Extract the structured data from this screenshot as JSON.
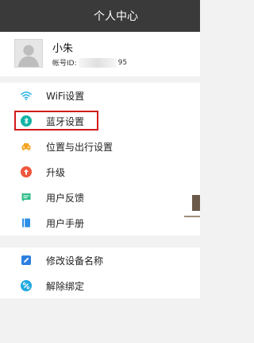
{
  "header": {
    "title": "个人中心"
  },
  "profile": {
    "name": "小朱",
    "account_label": "帐号ID:",
    "account_id_suffix": "95"
  },
  "menu_group_1": [
    {
      "label": "WiFi设置",
      "icon": "wifi-icon",
      "color": "#2db2e8"
    },
    {
      "label": "蓝牙设置",
      "icon": "bluetooth-icon",
      "color": "#12b3a5"
    },
    {
      "label": "位置与出行设置",
      "icon": "car-icon",
      "color": "#f5a623"
    },
    {
      "label": "升级",
      "icon": "upgrade-icon",
      "color": "#f0563c"
    },
    {
      "label": "用户反馈",
      "icon": "feedback-icon",
      "color": "#2fbf8a"
    },
    {
      "label": "用户手册",
      "icon": "manual-icon",
      "color": "#2d8fe6"
    }
  ],
  "menu_group_2": [
    {
      "label": "修改设备名称",
      "icon": "edit-icon",
      "color": "#2d7fe0"
    },
    {
      "label": "解除绑定",
      "icon": "unbind-icon",
      "color": "#1fa8e0"
    }
  ],
  "colors": {
    "header_bg": "#3a3a3a",
    "highlight_border": "#d21b1b",
    "background": "#f2f2f2"
  }
}
